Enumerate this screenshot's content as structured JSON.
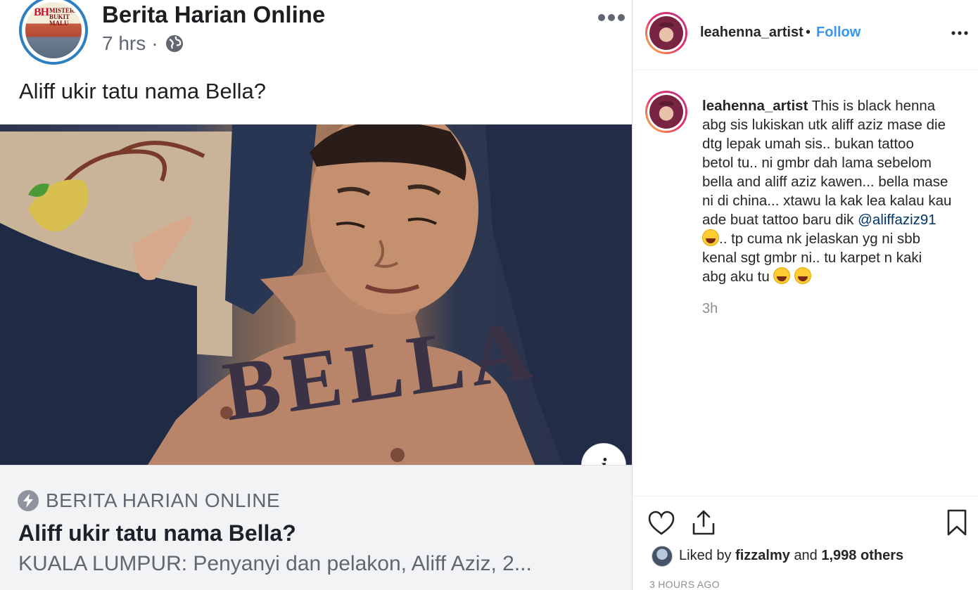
{
  "facebook_post": {
    "page_name": "Berita Harian Online",
    "time": "7 hrs",
    "separator": "·",
    "avatar_text": "BH",
    "avatar_subtext": "MISTERI BUKIT MALU",
    "caption": "Aliff ukir tatu nama Bella?",
    "info_button": "i",
    "link": {
      "source": "BERITA HARIAN ONLINE",
      "title": "Aliff ukir tatu nama Bella?",
      "description": "KUALA LUMPUR: Penyanyi dan pelakon, Aliff Aziz, 2..."
    },
    "icons": [
      "globe-icon",
      "more-icon",
      "info-icon",
      "bolt-icon"
    ]
  },
  "instagram_panel": {
    "header": {
      "username": "leahenna_artist",
      "separator": "•",
      "follow_label": "Follow"
    },
    "comment": {
      "username": "leahenna_artist",
      "lines": [
        " This is black henna",
        "abg sis lukiskan utk aliff aziz mase die",
        "dtg lepak umah sis.. bukan tattoo",
        "betol tu.. ni gmbr dah lama sebelom",
        "bella and aliff aziz kawen... bella mase",
        "ni di china... xtawu la kak lea kalau kau",
        "ade buat tattoo baru dik "
      ],
      "mention": "@aliffaziz91",
      "line8": ".. tp cuma nk jelaskan yg ni sbb",
      "line9": "kenal sgt gmbr ni.. tu karpet n kaki",
      "line10": "abg aku tu ",
      "time": "3h"
    },
    "likes": {
      "prefix": "Liked by",
      "user": "fizzalmy",
      "conjunction": "and",
      "others": "1,998 others"
    },
    "posted_ago": "3 HOURS AGO",
    "icons": [
      "heart-icon",
      "share-icon",
      "bookmark-icon",
      "more-icon"
    ],
    "accent_color": "#3897f0"
  }
}
